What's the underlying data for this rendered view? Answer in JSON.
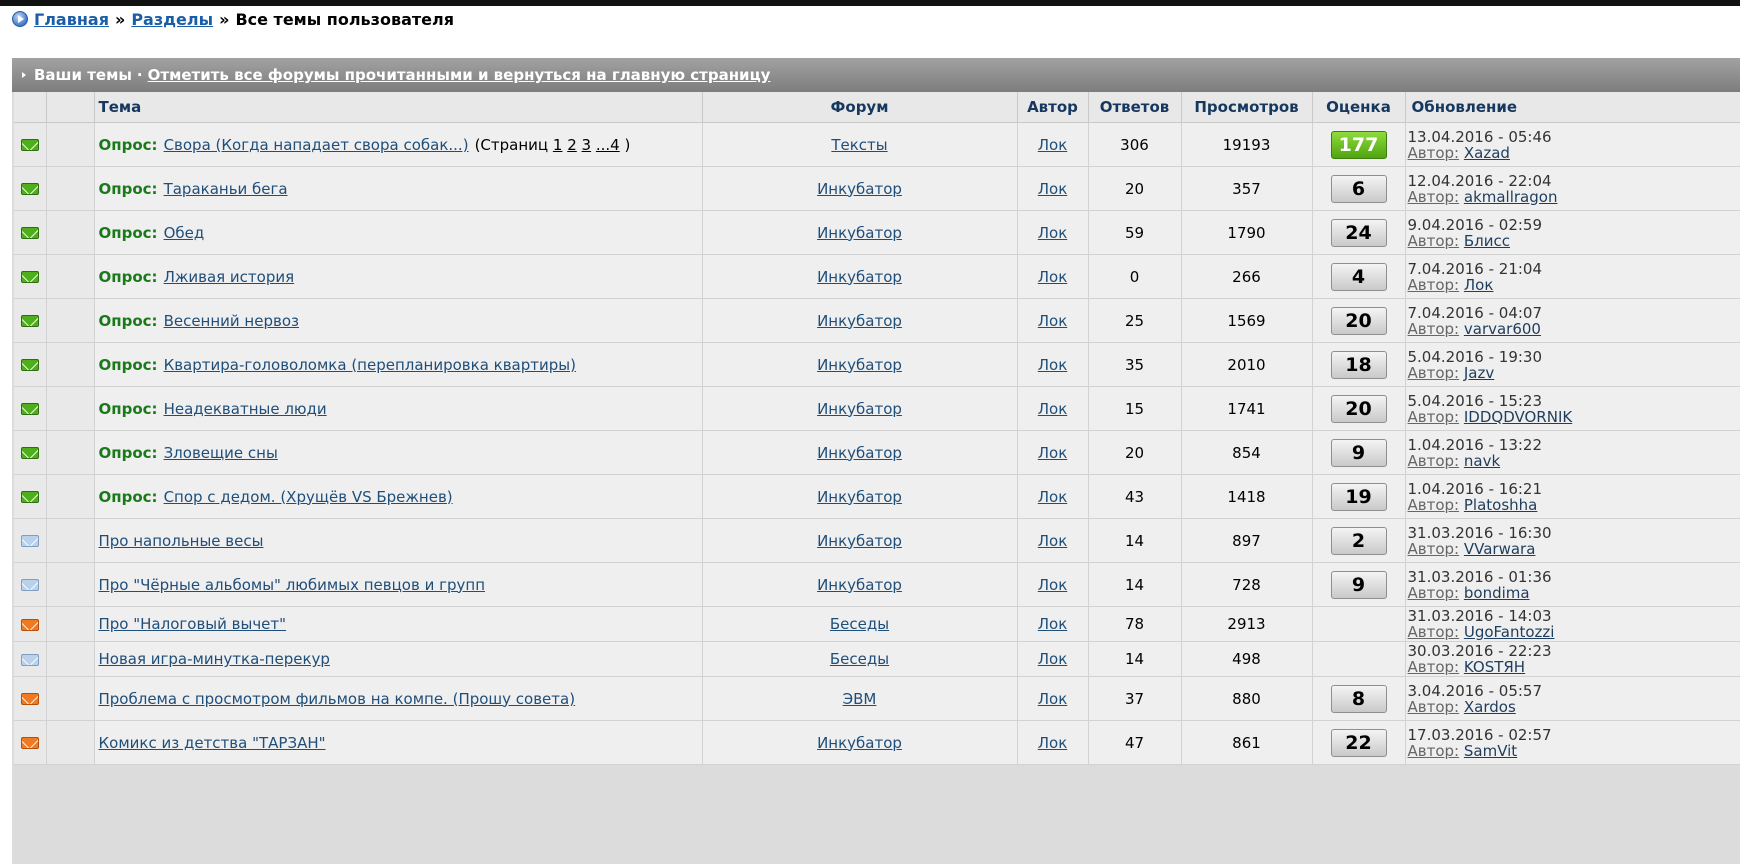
{
  "breadcrumb": {
    "home": "Главная",
    "sections": "Разделы",
    "current": "Все темы пользователя",
    "sep": "»"
  },
  "panel": {
    "title": "Ваши темы",
    "mark_all": "Отметить все форумы прочитанными и вернуться на главную страницу"
  },
  "columns": {
    "topic": "Тема",
    "forum": "Форум",
    "author": "Автор",
    "replies": "Ответов",
    "views": "Просмотров",
    "rating": "Оценка",
    "update": "Обновление"
  },
  "labels": {
    "poll": "Опрос:",
    "author_prefix": "Автор:",
    "pages": "(Страниц",
    "pages_close": ")"
  },
  "colors": {
    "new_icon": "#4fae1b",
    "read_icon": "#b9d1ea",
    "hot_icon": "#f07a22",
    "poll_label": "#1a7a1a",
    "hot_badge": "#6cc12a"
  },
  "topics": [
    {
      "icon": "new",
      "poll": true,
      "title": "Свора (Когда нападает свора собак...)",
      "pages": [
        "1",
        "2",
        "3",
        "...4"
      ],
      "forum": "Тексты",
      "author": "Лок",
      "replies": "306",
      "views": "19193",
      "rating": "177",
      "rating_hot": true,
      "updated": "13.04.2016 - 05:46",
      "last_author": "Xazad"
    },
    {
      "icon": "new",
      "poll": true,
      "title": "Тараканьи бега",
      "forum": "Инкубатор",
      "author": "Лок",
      "replies": "20",
      "views": "357",
      "rating": "6",
      "updated": "12.04.2016 - 22:04",
      "last_author": "akmallragon"
    },
    {
      "icon": "new",
      "poll": true,
      "title": "Обед",
      "forum": "Инкубатор",
      "author": "Лок",
      "replies": "59",
      "views": "1790",
      "rating": "24",
      "updated": "9.04.2016 - 02:59",
      "last_author": "Блисс"
    },
    {
      "icon": "new",
      "poll": true,
      "title": "Лживая история",
      "forum": "Инкубатор",
      "author": "Лок",
      "replies": "0",
      "views": "266",
      "rating": "4",
      "updated": "7.04.2016 - 21:04",
      "last_author": "Лок"
    },
    {
      "icon": "new",
      "poll": true,
      "title": "Весенний нервоз",
      "forum": "Инкубатор",
      "author": "Лок",
      "replies": "25",
      "views": "1569",
      "rating": "20",
      "updated": "7.04.2016 - 04:07",
      "last_author": "varvar600"
    },
    {
      "icon": "new",
      "poll": true,
      "title": "Квартира-головоломка (перепланировка квартиры)",
      "forum": "Инкубатор",
      "author": "Лок",
      "replies": "35",
      "views": "2010",
      "rating": "18",
      "updated": "5.04.2016 - 19:30",
      "last_author": "Jazv"
    },
    {
      "icon": "new",
      "poll": true,
      "title": "Неадекватные люди",
      "forum": "Инкубатор",
      "author": "Лок",
      "replies": "15",
      "views": "1741",
      "rating": "20",
      "updated": "5.04.2016 - 15:23",
      "last_author": "IDDQDVORNIK"
    },
    {
      "icon": "new",
      "poll": true,
      "title": "Зловещие сны",
      "forum": "Инкубатор",
      "author": "Лок",
      "replies": "20",
      "views": "854",
      "rating": "9",
      "updated": "1.04.2016 - 13:22",
      "last_author": "navk"
    },
    {
      "icon": "new",
      "poll": true,
      "title": "Спор с дедом. (Хрущёв VS Брежнев)",
      "forum": "Инкубатор",
      "author": "Лок",
      "replies": "43",
      "views": "1418",
      "rating": "19",
      "updated": "1.04.2016 - 16:21",
      "last_author": "Platoshha"
    },
    {
      "icon": "read",
      "poll": false,
      "title": "Про напольные весы",
      "forum": "Инкубатор",
      "author": "Лок",
      "replies": "14",
      "views": "897",
      "rating": "2",
      "updated": "31.03.2016 - 16:30",
      "last_author": "VVarwara"
    },
    {
      "icon": "read",
      "poll": false,
      "title": "Про \"Чёрные альбомы\" любимых певцов и групп",
      "forum": "Инкубатор",
      "author": "Лок",
      "replies": "14",
      "views": "728",
      "rating": "9",
      "updated": "31.03.2016 - 01:36",
      "last_author": "bondima"
    },
    {
      "icon": "hot",
      "poll": false,
      "title": "Про \"Налоговый вычет\"",
      "forum": "Беседы",
      "author": "Лок",
      "replies": "78",
      "views": "2913",
      "rating": "",
      "updated": "31.03.2016 - 14:03",
      "last_author": "UgoFantozzi"
    },
    {
      "icon": "read",
      "poll": false,
      "title": "Новая игра-минутка-перекур",
      "forum": "Беседы",
      "author": "Лок",
      "replies": "14",
      "views": "498",
      "rating": "",
      "updated": "30.03.2016 - 22:23",
      "last_author": "KOSTЯH"
    },
    {
      "icon": "hot",
      "poll": false,
      "title": "Проблема с просмотром фильмов на компе. (Прошу совета)",
      "forum": "ЭВМ",
      "author": "Лок",
      "replies": "37",
      "views": "880",
      "rating": "8",
      "updated": "3.04.2016 - 05:57",
      "last_author": "Xardos"
    },
    {
      "icon": "hot",
      "poll": false,
      "title": "Комикс из детства \"ТАРЗАН\"",
      "forum": "Инкубатор",
      "author": "Лок",
      "replies": "47",
      "views": "861",
      "rating": "22",
      "updated": "17.03.2016 - 02:57",
      "last_author": "SamVit"
    }
  ]
}
